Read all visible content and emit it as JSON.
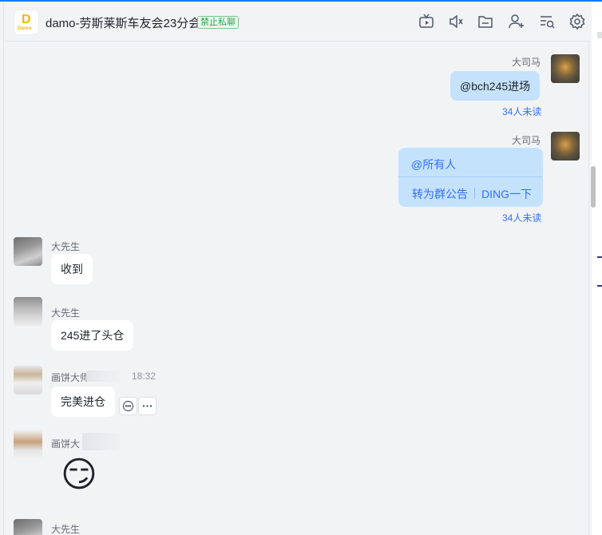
{
  "header": {
    "title": "damo-劳斯莱斯车友会23分会",
    "tag": "禁止私聊",
    "logo_letter": "D",
    "logo_text": "Damo"
  },
  "toolbar": {
    "icons": [
      "tv-icon",
      "mute-icon",
      "folder-icon",
      "add-member-icon",
      "search-history-icon",
      "settings-icon"
    ]
  },
  "messages": [
    {
      "sender": "大司马",
      "text": "@bch245进场",
      "read_status": "34人未读"
    },
    {
      "sender": "大司马",
      "mention": "@所有人",
      "actions": [
        "转为群公告",
        "DING一下"
      ],
      "read_status": "34人未读"
    },
    {
      "sender": "大先生",
      "text": "收到"
    },
    {
      "sender": "大先生",
      "text": "245进了头仓"
    },
    {
      "sender": "画饼大师",
      "time": "18:32",
      "text": "完美进仓"
    },
    {
      "sender": "画饼大",
      "emoji": "😏"
    },
    {
      "sender": "大先生"
    }
  ],
  "colors": {
    "accent": "#3370ff",
    "my_bubble": "#c5e2fd",
    "other_bubble": "#ffffff",
    "tag_green": "#2ba44c"
  }
}
